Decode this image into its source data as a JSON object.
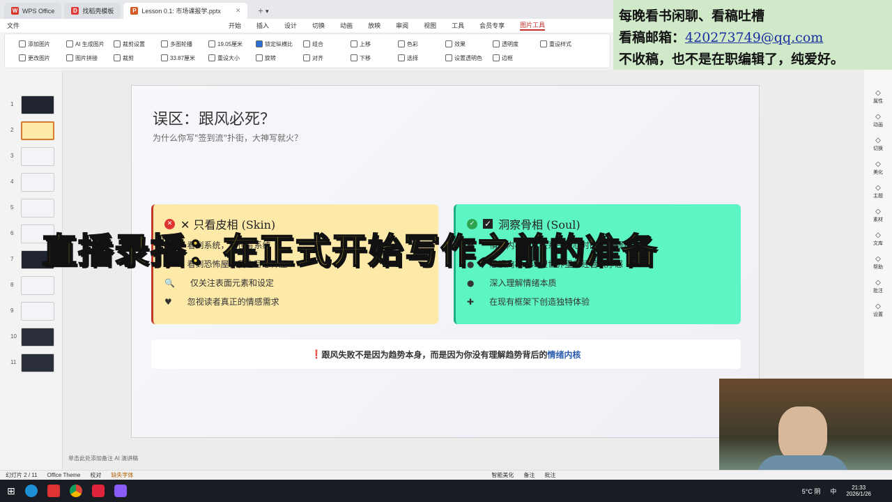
{
  "tabs": [
    {
      "label": "WPS Office"
    },
    {
      "label": "找稻壳模板"
    },
    {
      "label": "Lesson 0.1: 市场课报学.pptx"
    }
  ],
  "menu": [
    {
      "label": "文件"
    },
    {
      "label": "开始"
    },
    {
      "label": "插入"
    },
    {
      "label": "设计"
    },
    {
      "label": "切换"
    },
    {
      "label": "动画"
    },
    {
      "label": "放映"
    },
    {
      "label": "审阅"
    },
    {
      "label": "视图"
    },
    {
      "label": "工具"
    },
    {
      "label": "会员专享"
    },
    {
      "label": "图片工具"
    }
  ],
  "ribbon": [
    "添加图片",
    "AI 生成图片",
    "裁剪设置",
    "多图轮播",
    "更改图片",
    "图片拼接",
    "裁剪",
    "19.05厘米",
    "33.87厘米",
    "锁定纵横比",
    "重设大小",
    "旋转",
    "组合",
    "对齐",
    "上移",
    "下移",
    "选择",
    "色彩",
    "设置透明色",
    "效果",
    "边框",
    "透明度",
    "重设样式"
  ],
  "slides": [
    "1",
    "2",
    "3",
    "4",
    "5",
    "6",
    "7",
    "8",
    "9",
    "10",
    "11"
  ],
  "slide": {
    "title": "误区：跟风必死？",
    "subtitle": "为什么你写\"签到流\"扑街，大神写就火？",
    "left": {
      "heading": "✕ 只看皮相 (Skin)",
      "items": [
        "看到系统，我也写系统",
        "看到恐怖屋，我也写恐怖屋",
        "仅关注表面元素和设定",
        "忽视读者真正的情感需求"
      ]
    },
    "right": {
      "heading": "洞察骨相 (Soul)",
      "items": [
        "情绪内核 - 度联系一核心时的\"鼓舞慰藉\"",
        "恐惧内核 - 渴望世界里的经营秩序感",
        "深入理解情绪本质",
        "在现有框架下创造独特体验"
      ]
    },
    "footer_text": "跟风失败不是因为趋势本身，而是因为你没有理解趋势背后的",
    "footer_highlight": "情绪内核"
  },
  "banner": "直播录播：在正式开始写作之前的准备",
  "note": {
    "line1": "每晚看书闲聊、看稿吐槽",
    "line2_label": "看稿邮箱：",
    "email": "420273749@qq.com",
    "line3": "不收稿，也不是在职编辑了，纯爱好。"
  },
  "right_panel": [
    "属性",
    "动画",
    "切换",
    "美化",
    "主题",
    "素材",
    "文库",
    "帮助",
    "批注",
    "设置"
  ],
  "notes_placeholder": "单击此处添加备注",
  "ai_notes": "AI 演讲稿",
  "status": {
    "slide": "幻灯片 2 / 11",
    "theme": "Office Theme",
    "proof": "校对",
    "font": "缺失字体",
    "beautify": "智能美化",
    "notes": "备注",
    "comments": "批注"
  },
  "taskbar": {
    "weather": "5°C 阴",
    "ime": "中",
    "time": "21:33",
    "date": "2026/1/26"
  },
  "colors": {
    "left_card": "#fde9a8",
    "right_card": "#5ef5c5",
    "accent": "#c7302a"
  }
}
